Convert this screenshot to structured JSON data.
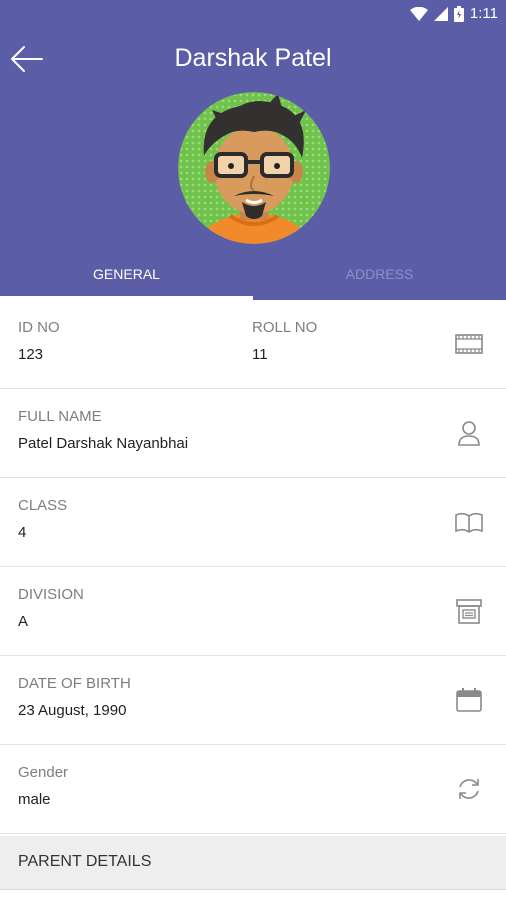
{
  "status_bar": {
    "time": "1:11",
    "icons": [
      "wifi-icon",
      "signal-icon",
      "battery-icon"
    ]
  },
  "header": {
    "title": "Darshak Patel",
    "back_icon": "arrow-left-icon",
    "background": "#5b5ea6"
  },
  "tabs": [
    {
      "label": "GENERAL",
      "active": true
    },
    {
      "label": "ADDRESS",
      "active": false
    }
  ],
  "rows": {
    "id_no": {
      "label": "ID NO",
      "value": "123"
    },
    "roll_no": {
      "label": "ROLL NO",
      "value": "11",
      "icon": "id-card-icon"
    },
    "full_name": {
      "label": "FULL NAME",
      "value": "Patel Darshak Nayanbhai",
      "icon": "person-icon"
    },
    "class": {
      "label": "CLASS",
      "value": "4",
      "icon": "book-icon"
    },
    "division": {
      "label": "DIVISION",
      "value": "A",
      "icon": "archive-icon"
    },
    "dob": {
      "label": "DATE OF BIRTH",
      "value": "23 August, 1990",
      "icon": "calendar-icon"
    },
    "gender": {
      "label": "Gender",
      "value": "male",
      "icon": "refresh-icon"
    }
  },
  "section": {
    "label": "PARENT DETAILS"
  }
}
